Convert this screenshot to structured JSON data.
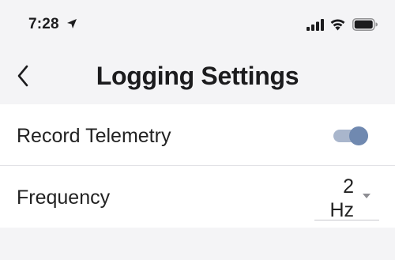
{
  "status_bar": {
    "time": "7:28",
    "icons": [
      "location-arrow-icon",
      "cellular-signal-icon",
      "wifi-icon",
      "battery-icon"
    ]
  },
  "nav": {
    "back_icon": "chevron-left-icon",
    "title": "Logging Settings"
  },
  "settings": {
    "record_telemetry": {
      "label": "Record Telemetry",
      "enabled": true
    },
    "frequency": {
      "label": "Frequency",
      "value": "2",
      "unit": "Hz"
    }
  },
  "colors": {
    "toggle_track": "#a9b6cc",
    "toggle_thumb": "#7089b0",
    "background": "#f4f4f6",
    "row_background": "#ffffff"
  }
}
